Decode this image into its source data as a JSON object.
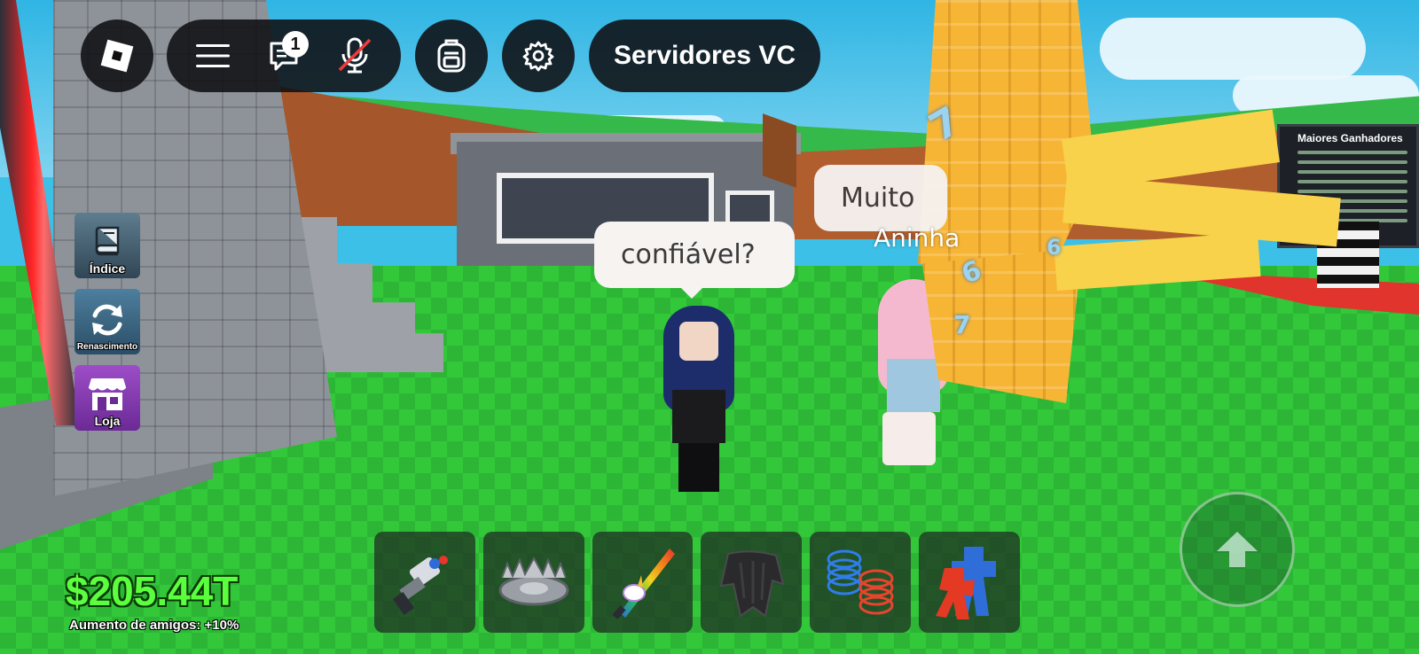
{
  "top_bar": {
    "chat_badge_count": "1",
    "servers_button_label": "Servidores VC"
  },
  "icons": {
    "roblox": "roblox-logo-icon",
    "menu": "hamburger-menu-icon",
    "chat": "chat-icon",
    "mic": "microphone-muted-icon",
    "backpack": "backpack-icon",
    "settings": "gear-icon",
    "jump": "arrow-up-icon"
  },
  "side_menu": {
    "items": [
      {
        "label": "Índice",
        "icon": "book-icon"
      },
      {
        "label": "Renascimento",
        "icon": "refresh-icon"
      },
      {
        "label": "Loja",
        "icon": "shop-icon"
      }
    ]
  },
  "chat_bubbles": {
    "bubble_1": "confiável?",
    "bubble_2": "Muito"
  },
  "player_name": "Aninha",
  "leaderboard": {
    "title": "Maiores Ganhadores"
  },
  "stats": {
    "money": "$205.44T",
    "friend_boost": "Aumento de amigos: +10%"
  },
  "hotbar": {
    "slots": [
      {
        "icon": "gadget-gun-icon"
      },
      {
        "icon": "bear-trap-icon"
      },
      {
        "icon": "unicorn-rainbow-sword-icon"
      },
      {
        "icon": "dark-cloak-icon"
      },
      {
        "icon": "coil-springs-icon"
      },
      {
        "icon": "red-blue-figure-icon"
      }
    ]
  },
  "colors": {
    "money_green": "#5cff3e",
    "hud_dark": "#0f0f12",
    "shop_purple": "#9d4dc7"
  }
}
